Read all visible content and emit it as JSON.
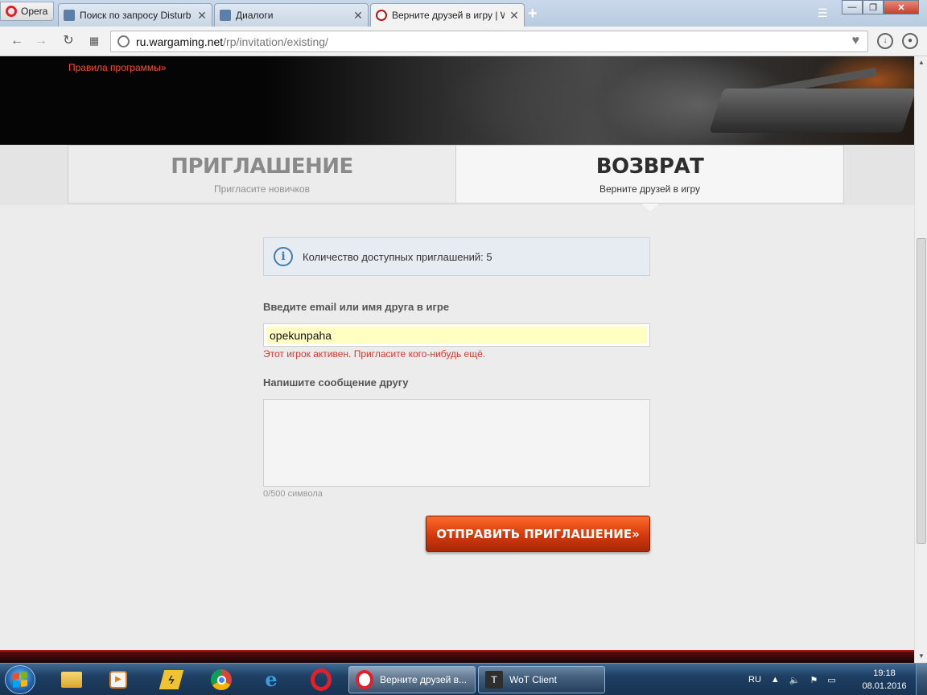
{
  "browser": {
    "menu_label": "Opera",
    "tabs": [
      {
        "title": "Поиск по запросу Disturb"
      },
      {
        "title": "Диалоги"
      },
      {
        "title": "Верните друзей в игру | W"
      }
    ],
    "url_host": "ru.wargaming.net",
    "url_path": "/rp/invitation/existing/"
  },
  "page": {
    "program_link": "Правила программы»",
    "tab_invite": {
      "title": "ПРИГЛАШЕНИЕ",
      "subtitle": "Пригласите новичков"
    },
    "tab_return": {
      "title": "ВОЗВРАТ",
      "subtitle": "Верните друзей в игру"
    },
    "info_text": "Количество доступных приглашений: 5",
    "email_label": "Введите email или имя друга в игре",
    "email_value": "opekunpaha",
    "error_text": "Этот игрок активен. Пригласите кого-нибудь ещё.",
    "message_label": "Напишите сообщение другу",
    "char_count": "0/500 символа",
    "send_button": "ОТПРАВИТЬ ПРИГЛАШЕНИЕ»"
  },
  "taskbar": {
    "windows": [
      {
        "title": "Верните друзей в..."
      },
      {
        "title": "WoT Client"
      }
    ],
    "language": "RU",
    "time": "19:18",
    "date": "08.01.2016"
  },
  "colors": {
    "accent_orange": "#d23a0c",
    "error_red": "#d33a2a",
    "info_blue": "#3f7cb5"
  }
}
